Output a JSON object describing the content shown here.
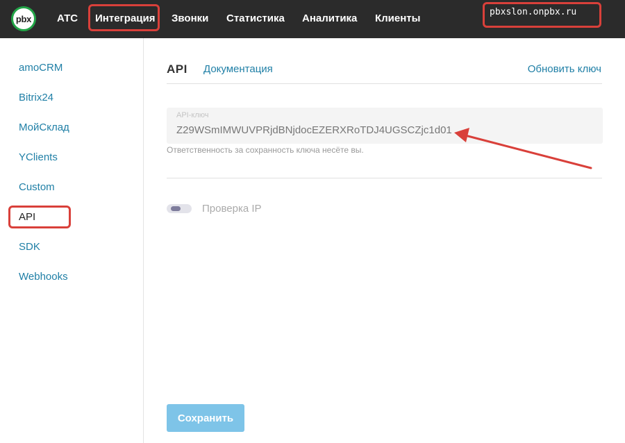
{
  "topbar": {
    "logo_text": "pbx",
    "nav": [
      "АТС",
      "Интеграция",
      "Звонки",
      "Статистика",
      "Аналитика",
      "Клиенты"
    ],
    "active_nav": "Интеграция",
    "domain": "pbxslon.onpbx.ru",
    "accent_color": "#22a447",
    "highlight_color": "#d9403a"
  },
  "sidebar": {
    "items": [
      "amoCRM",
      "Bitrix24",
      "МойСклад",
      "YClients",
      "Custom",
      "API",
      "SDK",
      "Webhooks"
    ],
    "active": "API"
  },
  "main": {
    "title": "API",
    "documentation_link": "Документация",
    "refresh_link": "Обновить ключ",
    "api_key": {
      "label": "API-ключ",
      "value": "Z29WSmIMWUVPRjdBNjdocEZERXRoTDJ4UGSCZjc1d01",
      "hint": "Ответственность за сохранность ключа несёте вы."
    },
    "ip_check": {
      "label": "Проверка IP",
      "enabled": false
    },
    "save_button": "Сохранить"
  }
}
